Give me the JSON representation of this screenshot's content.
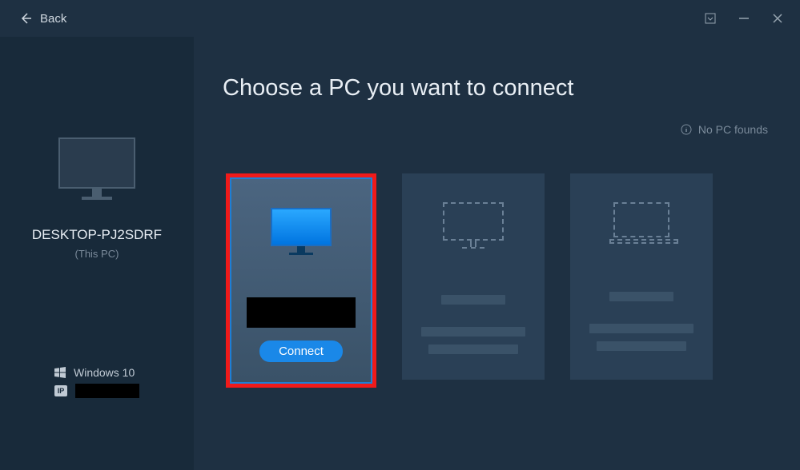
{
  "titlebar": {
    "back_label": "Back"
  },
  "sidebar": {
    "pc_name": "DESKTOP-PJ2SDRF",
    "pc_sub": "(This PC)",
    "os_label": "Windows 10",
    "ip_badge": "IP"
  },
  "content": {
    "heading": "Choose a PC you want to connect",
    "status": "No PC founds",
    "connect_label": "Connect"
  }
}
